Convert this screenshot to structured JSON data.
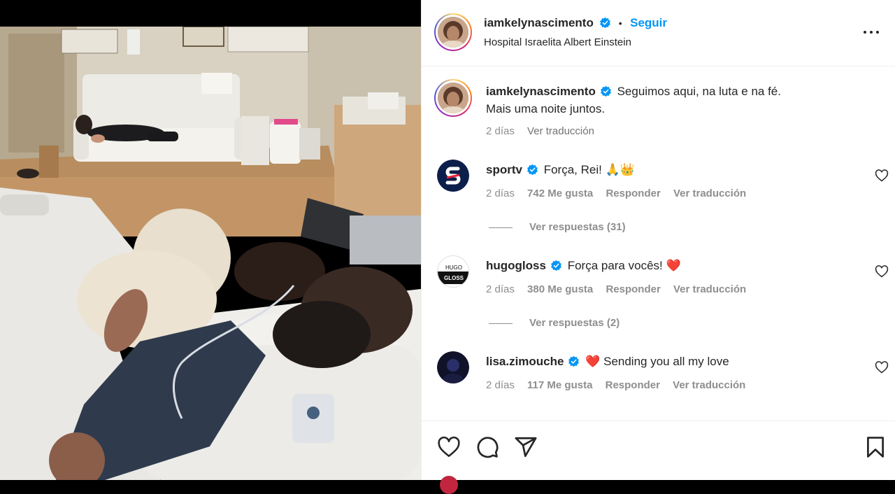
{
  "post": {
    "username": "iamkelynascimento",
    "follow_label": "Seguir",
    "location": "Hospital Israelita Albert Einstein",
    "separator": "•"
  },
  "caption": {
    "username": "iamkelynascimento",
    "line1": "Seguimos aqui, na luta e na fé.",
    "line2": "Mais uma noite juntos.",
    "time": "2 días",
    "translate_label": "Ver traducción"
  },
  "comments": [
    {
      "username": "sportv",
      "text": "Força, Rei! 🙏👑",
      "time": "2 días",
      "likes": "742 Me gusta",
      "reply_label": "Responder",
      "translate_label": "Ver traducción",
      "replies_label": "Ver respuestas (31)"
    },
    {
      "username": "hugogloss",
      "text": "Força para vocês! ❤️",
      "time": "2 días",
      "likes": "380 Me gusta",
      "reply_label": "Responder",
      "translate_label": "Ver traducción",
      "replies_label": "Ver respuestas (2)",
      "avatar_text": "HUGO GLOSS"
    },
    {
      "username": "lisa.zimouche",
      "text": "❤️ Sending you all my love",
      "time": "2 días",
      "likes": "117 Me gusta",
      "reply_label": "Responder",
      "translate_label": "Ver traducción"
    }
  ],
  "icons": {
    "verified": "verified-badge-icon",
    "more": "more-options-icon",
    "like": "heart-icon",
    "comment": "comment-icon",
    "share": "share-icon",
    "save": "bookmark-icon"
  },
  "colors": {
    "accent": "#0095f6",
    "text": "#262626",
    "muted": "#8e8e8e",
    "border": "#efefef"
  }
}
